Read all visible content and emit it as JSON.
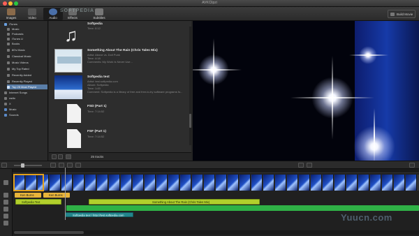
{
  "window": {
    "title": "AVKClipzi"
  },
  "toolbar": {
    "tabs": [
      {
        "label": "Images",
        "icon": "images-icon"
      },
      {
        "label": "Video",
        "icon": "video-icon"
      },
      {
        "label": "Audio",
        "icon": "audio-icon",
        "selected": true
      },
      {
        "label": "Effects",
        "icon": "effects-icon"
      },
      {
        "label": "Subtitles",
        "icon": "subtitles-icon"
      }
    ],
    "watermark": "SOFTPEDIA",
    "build_label": "Build Movie"
  },
  "sidebar": {
    "items": [
      {
        "label": "iTunes",
        "level": 0
      },
      {
        "label": "Music",
        "level": 1
      },
      {
        "label": "Podcasts",
        "level": 1
      },
      {
        "label": "iTunes U",
        "level": 1
      },
      {
        "label": "Books",
        "level": 1
      },
      {
        "label": "80's Music",
        "level": 1
      },
      {
        "label": "Classical Music",
        "level": 1
      },
      {
        "label": "Music Videos",
        "level": 1
      },
      {
        "label": "My Top Rated",
        "level": 1
      },
      {
        "label": "Recently Added",
        "level": 1
      },
      {
        "label": "Recently Played",
        "level": 1
      },
      {
        "label": "Top 25 Most Played",
        "level": 1,
        "selected": true
      },
      {
        "label": "Internet Songs",
        "level": 0
      },
      {
        "label": "radio",
        "level": 0
      },
      {
        "label": "X",
        "level": 0
      },
      {
        "label": "Music",
        "level": 0
      },
      {
        "label": "Sounds",
        "level": 0
      }
    ]
  },
  "media": {
    "tracks": [
      {
        "title": "Softpedia",
        "meta": [
          "Time: 0:12"
        ]
      },
      {
        "title": "Something About The Rain (Chris Tales Mix)",
        "meta": [
          "Artist: Above vs. Doll Punk",
          "Time: 4:18",
          "Comments: My Work Is Never Use..."
        ]
      },
      {
        "title": "Softpedia test",
        "meta": [
          "Artist: test.softpedia.com",
          "Album: Softpedia",
          "Time: 1:45",
          "Comment: Softpedia is a library of free and free-to-try software programs fo..."
        ]
      },
      {
        "title": "FSD (Part 1)",
        "meta": [
          "Time: 7:14:52"
        ]
      },
      {
        "title": "FSF (Part 1)",
        "meta": [
          "Time: 7:14:52"
        ]
      }
    ],
    "count_label": "25 tracks"
  },
  "timeline": {
    "title_clips": [
      "Ken Burns",
      "Ken Burns"
    ],
    "audio_clips": [
      "Softpedia Text",
      "Something About The Rain (Chris Tales Mix)"
    ],
    "subtitle_clip": "Softpedia text | http://test.softpedia.com"
  },
  "site_watermark": "Yuucn.com",
  "colors": {
    "selection": "#5a7ea8",
    "title_clip": "#e8b43a",
    "audio_clip": "#b2cf2c",
    "subtitle_clip": "#23868c",
    "video_selection": "#e3a11b"
  }
}
